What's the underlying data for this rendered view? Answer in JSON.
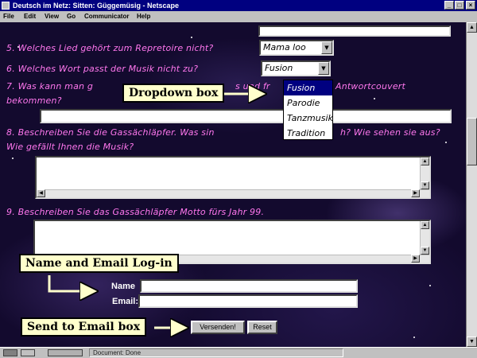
{
  "window": {
    "title": "Deutsch im Netz: Sitten: Güggemüsig - Netscape",
    "controls": [
      "_",
      "□",
      "×"
    ]
  },
  "menu": [
    "File",
    "Edit",
    "View",
    "Go",
    "Communicator",
    "Help"
  ],
  "questions": {
    "q5": "5. Welches Lied gehört zum Repretoire nicht?",
    "q6": "6. Welches Wort passt der Musik nicht zu?",
    "q7_line1": "7. Was kann man g",
    "q7_line1_right": "s und fr",
    "q7_line1_far": "Antwortcouvert",
    "q7_line2": "bekommen?",
    "q8_line1": "8.  Beschreiben Sie die Gassächläpfer.   Was sin",
    "q8_line1_right": "h?   Wie sehen sie aus?",
    "q8_line2": "Wie gefällt Ihnen die Musik?",
    "q9": "9.  Beschreiben Sie das Gassächläpfer Motto fürs Jahr 99."
  },
  "selects": {
    "q5_value": "Mama loo",
    "q6_value": "Fusion"
  },
  "dropdown": {
    "options": [
      "Fusion",
      "Parodie",
      "Tanzmusik",
      "Tradition"
    ],
    "selected_index": 0
  },
  "callouts": {
    "dropdown": "Dropdown box",
    "login": "Name and Email Log-in",
    "send": "Send to Email box"
  },
  "form": {
    "name_label": "Name",
    "email_label": "Email:",
    "name_value": "",
    "email_value": "",
    "submit_label": "Versenden!",
    "reset_label": "Reset"
  },
  "status": {
    "text": "Document: Done"
  },
  "colors": {
    "question_text": "#ff77ee",
    "titlebar": "#000080",
    "callout_bg": "#ffffcc"
  }
}
